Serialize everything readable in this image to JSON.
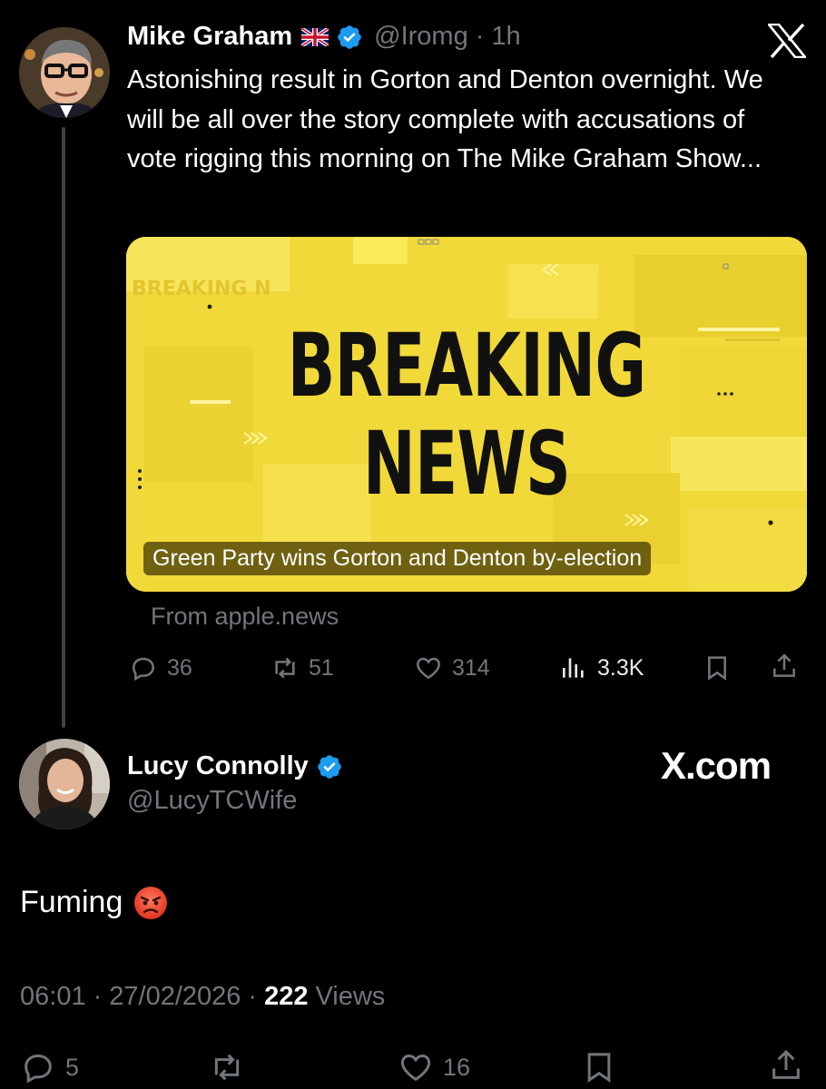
{
  "tweet1": {
    "name": "Mike Graham",
    "flag_emoji": "🇬🇧",
    "handle": "@Iromg",
    "separator": "·",
    "time": "1h",
    "text": "Astonishing result in Gorton and Denton overnight. We will be all over the story complete with accusations of vote rigging this morning on The Mike Graham Show...",
    "card": {
      "headline_line1": "BREAKING",
      "headline_line2": "NEWS",
      "bg_text": "BREAKING N",
      "caption": "Green Party wins Gorton and Denton by-election",
      "source": "From apple.news"
    },
    "actions": {
      "replies": "36",
      "reposts": "51",
      "likes": "314",
      "views": "3.3K"
    }
  },
  "tweet2": {
    "name": "Lucy Connolly",
    "handle": "@LucyTCWife",
    "text": "Fuming",
    "emoji": "😡",
    "time": "06:01",
    "date": "27/02/2026",
    "views_count": "222",
    "views_label": "Views",
    "separator": "·",
    "actions": {
      "replies": "5",
      "likes": "16"
    }
  },
  "brand": {
    "logo_text": "X.com"
  },
  "colors": {
    "background": "#000000",
    "text": "#ffffff",
    "muted": "#71767b",
    "verified": "#1d9bf0",
    "card_yellow": "#f3dc3a"
  }
}
